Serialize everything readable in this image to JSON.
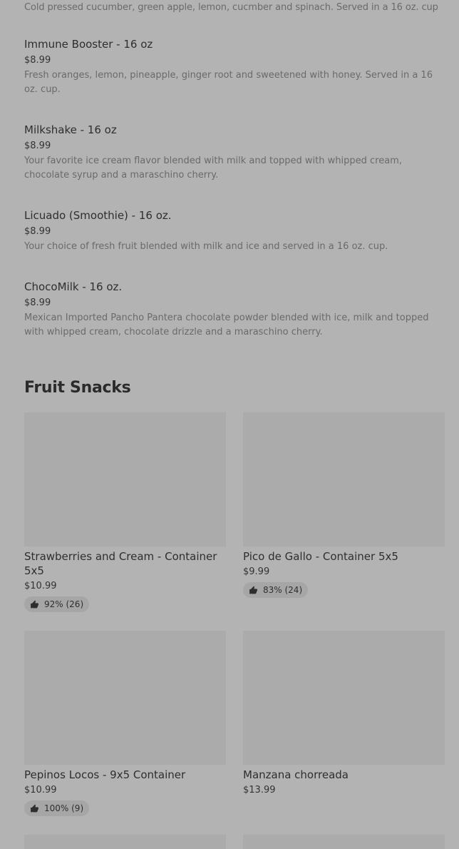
{
  "drinks": {
    "top_desc": "Cold pressed cucumber, green apple, lemon, cucmber and spinach. Served in a 16 oz. cup",
    "items": [
      {
        "name": "Immune Booster - 16 oz",
        "price": "$8.99",
        "desc": "Fresh oranges, lemon, pineapple, ginger root and sweetened with honey. Served in a 16 oz. cup."
      },
      {
        "name": "Milkshake - 16 oz",
        "price": "$8.99",
        "desc": "Your favorite ice cream flavor blended with milk and topped with whipped cream, chocolate syrup and a maraschino cherry."
      },
      {
        "name": "Licuado (Smoothie) - 16 oz.",
        "price": "$8.99",
        "desc": "Your choice of fresh fruit blended with milk and ice and served in a 16 oz. cup."
      },
      {
        "name": "ChocoMilk - 16 oz.",
        "price": "$8.99",
        "desc": "Mexican Imported Pancho Pantera chocolate powder blended with ice, milk and topped with whipped cream, chocolate drizzle and a maraschino cherry."
      }
    ]
  },
  "section": {
    "title": "Fruit Snacks"
  },
  "cards": [
    {
      "title": "Strawberries and Cream -  Container 5x5",
      "price": "$10.99",
      "rating": "92% (26)"
    },
    {
      "title": "Pico de Gallo - Container 5x5",
      "price": "$9.99",
      "rating": "83% (24)"
    },
    {
      "title": "Pepinos Locos - 9x5 Container",
      "price": "$10.99",
      "rating": "100% (9)"
    },
    {
      "title": "Manzana chorreada",
      "price": "$13.99"
    }
  ],
  "icons": {
    "thumbs_up": "thumbs-up-icon"
  },
  "colors": {
    "background": "#b3b3b3",
    "image_placeholder": "#ababab",
    "badge_bg": "#a6a6a6"
  }
}
